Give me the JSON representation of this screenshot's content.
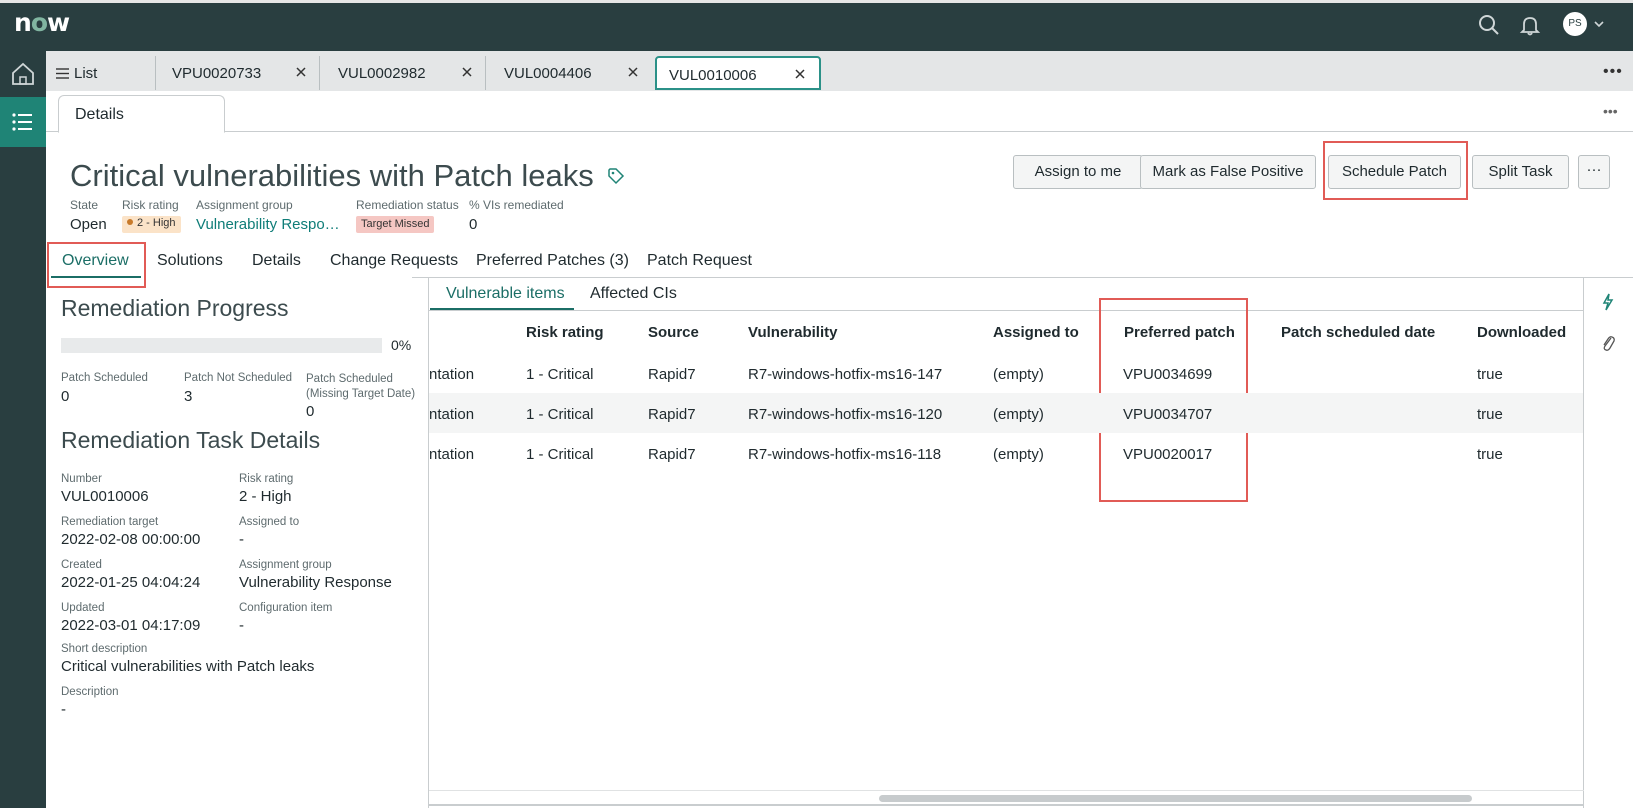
{
  "app": {
    "logo": "now"
  },
  "header": {
    "user_initials": "PS"
  },
  "tabs": [
    {
      "label": "List"
    },
    {
      "label": "VPU0020733"
    },
    {
      "label": "VUL0002982"
    },
    {
      "label": "VUL0004406"
    },
    {
      "label": "VUL0010006"
    }
  ],
  "subtab": {
    "label": "Details"
  },
  "record": {
    "title": "Critical vulnerabilities with Patch leaks",
    "fields": {
      "state_label": "State",
      "state_value": "Open",
      "risk_label": "Risk rating",
      "risk_value": "2 - High",
      "group_label": "Assignment group",
      "group_value": "Vulnerability Respo…",
      "remediation_label": "Remediation status",
      "remediation_value": "Target Missed",
      "vis_label": "% VIs remediated",
      "vis_value": "0"
    },
    "actions": {
      "assign": "Assign to me",
      "false_positive": "Mark as False Positive",
      "schedule": "Schedule Patch",
      "split": "Split Task",
      "more": "···"
    },
    "tabs": [
      "Overview",
      "Solutions",
      "Details",
      "Change Requests",
      "Preferred Patches (3)",
      "Patch Request"
    ]
  },
  "progress": {
    "title": "Remediation Progress",
    "percent_label": "0%",
    "percent": 0,
    "stats": [
      {
        "label": "Patch Scheduled",
        "value": "0"
      },
      {
        "label": "Patch Not Scheduled",
        "value": "3"
      },
      {
        "label": "Patch Scheduled (Missing Target Date)",
        "value": "0"
      }
    ]
  },
  "task_details": {
    "title": "Remediation Task Details",
    "number_label": "Number",
    "number_value": "VUL0010006",
    "risk_label": "Risk rating",
    "risk_value": "2 - High",
    "target_label": "Remediation target",
    "target_value": "2022-02-08 00:00:00",
    "assigned_label": "Assigned to",
    "assigned_value": "-",
    "created_label": "Created",
    "created_value": "2022-01-25 04:04:24",
    "group_label": "Assignment group",
    "group_value": "Vulnerability Response",
    "updated_label": "Updated",
    "updated_value": "2022-03-01 04:17:09",
    "ci_label": "Configuration item",
    "ci_value": "-",
    "short_label": "Short description",
    "short_value": "Critical vulnerabilities with Patch leaks",
    "desc_label": "Description",
    "desc_value": "-"
  },
  "table": {
    "tabs": [
      "Vulnerable items",
      "Affected CIs"
    ],
    "columns": [
      "Risk rating",
      "Source",
      "Vulnerability",
      "Assigned to",
      "Preferred patch",
      "Patch scheduled date",
      "Downloaded"
    ],
    "rows": [
      {
        "c0": "ntation",
        "risk": "1 - Critical",
        "source": "Rapid7",
        "vuln": "R7-windows-hotfix-ms16-147",
        "assigned": "(empty)",
        "patch": "VPU0034699",
        "date": "",
        "downloaded": "true"
      },
      {
        "c0": "ntation",
        "risk": "1 - Critical",
        "source": "Rapid7",
        "vuln": "R7-windows-hotfix-ms16-120",
        "assigned": "(empty)",
        "patch": "VPU0034707",
        "date": "",
        "downloaded": "true"
      },
      {
        "c0": "ntation",
        "risk": "1 - Critical",
        "source": "Rapid7",
        "vuln": "R7-windows-hotfix-ms16-118",
        "assigned": "(empty)",
        "patch": "VPU0020017",
        "date": "",
        "downloaded": "true"
      }
    ]
  },
  "colors": {
    "topbar": "#293e40",
    "accent": "#1f8476",
    "link": "#0f7d78",
    "highlight": "#e15b56"
  }
}
